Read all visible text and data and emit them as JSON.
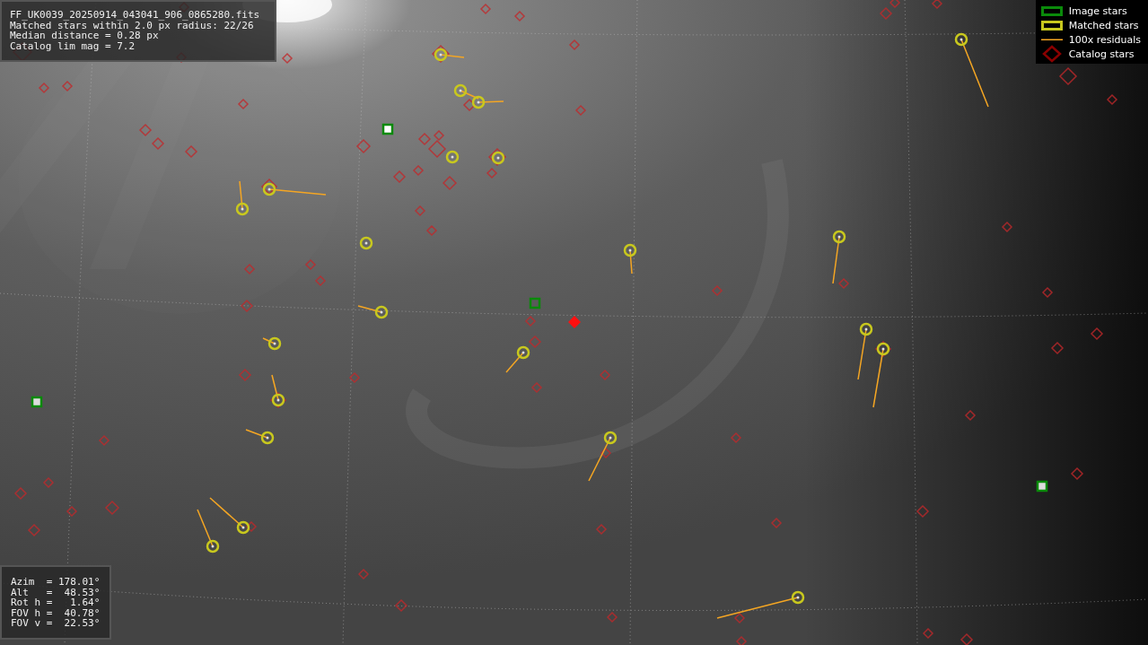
{
  "info_panel": {
    "lines": [
      "FF_UK0039_20250914_043041_906_0865280.fits",
      "Matched stars within 2.0 px radius: 22/26",
      "Median distance = 0.28 px",
      "Catalog lim mag = 7.2"
    ]
  },
  "legend": [
    {
      "label": "Image stars"
    },
    {
      "kind": "matched",
      "label": "Matched stars"
    },
    {
      "kind": "residual",
      "label": "100x residuals"
    },
    {
      "kind": "catalog",
      "label": "Catalog stars"
    }
  ],
  "pointing_panel": {
    "lines": [
      "Azim  = 178.01°",
      "Alt   =  48.53°",
      "Rot h =   1.64°",
      "FOV h =  40.78°",
      "FOV v =  22.53°"
    ]
  }
}
